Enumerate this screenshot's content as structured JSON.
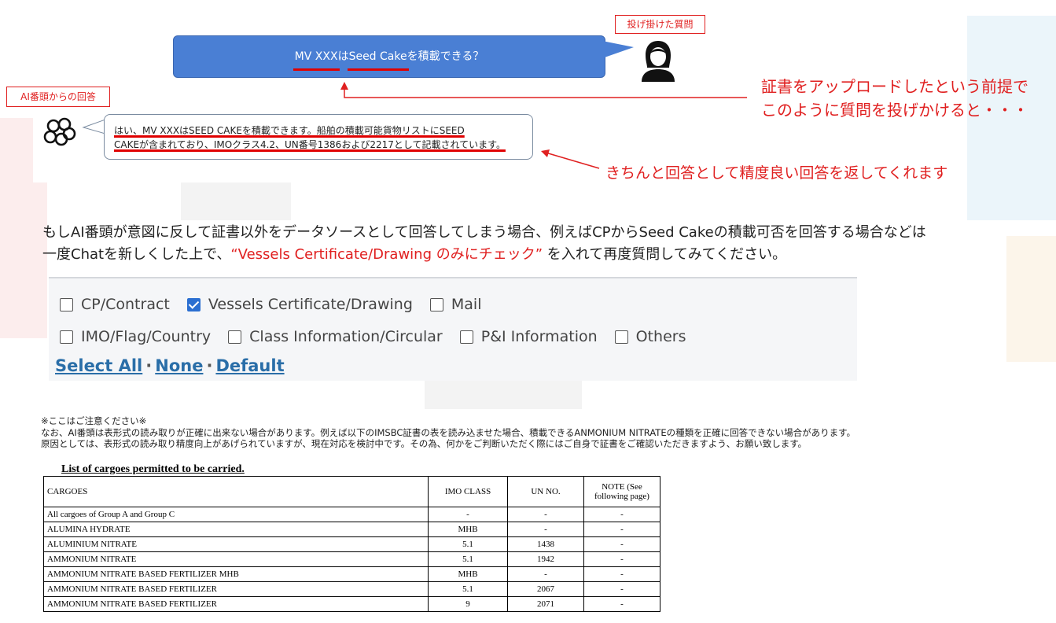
{
  "chat": {
    "question_tag": "投げ掛けた質問",
    "question_part1": "MV XXX",
    "question_part2": "は",
    "question_part3": "Seed Cake",
    "question_part4": "を積載できる？",
    "ai_tag": "AI番頭からの回答",
    "answer_line1": "はい、MV XXXはSEED CAKEを積載できます。船舶の積載可能貨物リストにSEED",
    "answer_line2": "CAKEが含まれており、IMOクラス4.2、UN番号1386および2217として記載されています。"
  },
  "annotations": {
    "upload_note_line1": "証書をアップロードしたという前提で",
    "upload_note_line2": "このように質問を投げかけると・・・",
    "answer_note": "きちんと回答として精度良い回答を返してくれます"
  },
  "instruction": {
    "line1": "もしAI番頭が意図に反して証書以外をデータソースとして回答してしまう場合、例えばCPからSeed Cakeの積載可否を回答する場合などは",
    "line2_pre": "一度Chatを新しくした上で、",
    "line2_red": "“Vessels Certificate/Drawing のみにチェック”",
    "line2_post": " を入れて再度質問してみてください。"
  },
  "filters": {
    "row1": [
      {
        "label": "CP/Contract",
        "checked": false
      },
      {
        "label": "Vessels Certificate/Drawing",
        "checked": true
      },
      {
        "label": "Mail",
        "checked": false
      }
    ],
    "row2": [
      {
        "label": "IMO/Flag/Country",
        "checked": false
      },
      {
        "label": "Class Information/Circular",
        "checked": false
      },
      {
        "label": "P&I Information",
        "checked": false
      },
      {
        "label": "Others",
        "checked": false
      }
    ],
    "select_all": "Select All",
    "none": "None",
    "default": "Default",
    "separator": "·"
  },
  "caution": {
    "heading": "※ここはご注意ください※",
    "line1": "なお、AI番頭は表形式の読み取りが正確に出来ない場合があります。例えば以下のIMSBC証書の表を読み込ませた場合、積載できるANMONIUM NITRATEの種類を正確に回答できない場合があります。",
    "line2": "原因としては、表形式の読み取り精度向上があげられていますが、現在対応を検討中です。その為、何かをご判断いただく際にはご自身で証書をご確認いただきますよう、お願い致します。"
  },
  "cargo_table": {
    "title": "List of cargoes permitted to be carried.",
    "headers": [
      "CARGOES",
      "IMO CLASS",
      "UN NO.",
      "NOTE (See following page)"
    ],
    "rows": [
      [
        "All cargoes of Group A and Group C",
        "-",
        "-",
        "-"
      ],
      [
        "ALUMINA HYDRATE",
        "MHB",
        "-",
        "-"
      ],
      [
        "ALUMINIUM NITRATE",
        "5.1",
        "1438",
        "-"
      ],
      [
        "AMMONIUM NITRATE",
        "5.1",
        "1942",
        "-"
      ],
      [
        "AMMONIUM NITRATE BASED FERTILIZER MHB",
        "MHB",
        "-",
        "-"
      ],
      [
        "AMMONIUM NITRATE BASED FERTILIZER",
        "5.1",
        "2067",
        "-"
      ],
      [
        "AMMONIUM NITRATE BASED FERTILIZER",
        "9",
        "2071",
        "-"
      ]
    ]
  },
  "colors": {
    "accent_red": "#e02020",
    "bubble_blue": "#4a7fd4",
    "link_blue": "#2a6ea8",
    "checkbox_blue": "#2b6fd1"
  }
}
